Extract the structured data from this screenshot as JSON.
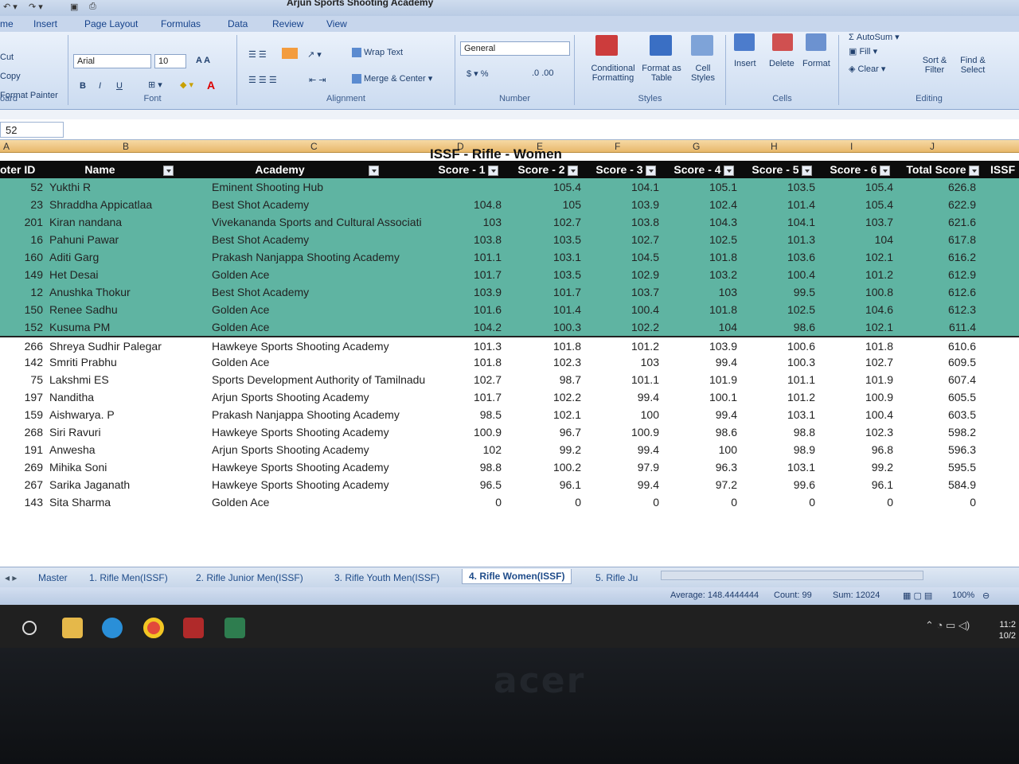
{
  "window": {
    "title": "Arjun Sports Shooting Academy"
  },
  "tabs": [
    "me",
    "Insert",
    "Page Layout",
    "Formulas",
    "Data",
    "Review",
    "View"
  ],
  "ribbon": {
    "clipboard": {
      "cut": "Cut",
      "copy": "Copy",
      "format_painter": "Format Painter",
      "label": "oard"
    },
    "font": {
      "name": "Arial",
      "size": "10",
      "label": "Font"
    },
    "alignment": {
      "wrap": "Wrap Text",
      "merge": "Merge & Center",
      "label": "Alignment"
    },
    "number": {
      "format": "General",
      "label": "Number"
    },
    "styles": {
      "conditional": "Conditional Formatting",
      "format_table": "Format as Table",
      "cell_styles": "Cell Styles",
      "label": "Styles"
    },
    "cells": {
      "insert": "Insert",
      "delete": "Delete",
      "format": "Format",
      "label": "Cells"
    },
    "editing": {
      "autosum": "AutoSum",
      "fill": "Fill",
      "clear": "Clear",
      "sort": "Sort & Filter",
      "find": "Find & Select",
      "label": "Editing"
    }
  },
  "formula_bar": {
    "name_box": "52"
  },
  "columns": [
    "A",
    "B",
    "C",
    "D",
    "E",
    "F",
    "G",
    "H",
    "I",
    "J"
  ],
  "sheet": {
    "banner": "ISSF - Rifle - Women",
    "headers": [
      "oter ID",
      "Name",
      "Academy",
      "Score - 1",
      "Score - 2",
      "Score - 3",
      "Score - 4",
      "Score - 5",
      "Score - 6",
      "Total Score",
      "ISSF"
    ],
    "rows": [
      {
        "id": "52",
        "name": "Yukthi R",
        "academy": "Eminent Shooting Hub",
        "s1": "",
        "s2": "105.4",
        "s3": "104.1",
        "s4": "105.1",
        "s5": "103.5",
        "s6": "105.4",
        "total": "626.8",
        "hl": true
      },
      {
        "id": "23",
        "name": "Shraddha Appicatlaa",
        "academy": "Best Shot Academy",
        "s1": "104.8",
        "s2": "105",
        "s3": "103.9",
        "s4": "102.4",
        "s5": "101.4",
        "s6": "105.4",
        "total": "622.9",
        "hl": true
      },
      {
        "id": "201",
        "name": "Kiran nandana",
        "academy": "Vivekananda Sports and Cultural Associati",
        "s1": "103",
        "s2": "102.7",
        "s3": "103.8",
        "s4": "104.3",
        "s5": "104.1",
        "s6": "103.7",
        "total": "621.6",
        "hl": true
      },
      {
        "id": "16",
        "name": "Pahuni Pawar",
        "academy": "Best Shot Academy",
        "s1": "103.8",
        "s2": "103.5",
        "s3": "102.7",
        "s4": "102.5",
        "s5": "101.3",
        "s6": "104",
        "total": "617.8",
        "hl": true
      },
      {
        "id": "160",
        "name": "Aditi Garg",
        "academy": "Prakash Nanjappa Shooting Academy",
        "s1": "101.1",
        "s2": "103.1",
        "s3": "104.5",
        "s4": "101.8",
        "s5": "103.6",
        "s6": "102.1",
        "total": "616.2",
        "hl": true
      },
      {
        "id": "149",
        "name": "Het Desai",
        "academy": "Golden Ace",
        "s1": "101.7",
        "s2": "103.5",
        "s3": "102.9",
        "s4": "103.2",
        "s5": "100.4",
        "s6": "101.2",
        "total": "612.9",
        "hl": true
      },
      {
        "id": "12",
        "name": "Anushka Thokur",
        "academy": "Best Shot Academy",
        "s1": "103.9",
        "s2": "101.7",
        "s3": "103.7",
        "s4": "103",
        "s5": "99.5",
        "s6": "100.8",
        "total": "612.6",
        "hl": true
      },
      {
        "id": "150",
        "name": "Renee Sadhu",
        "academy": "Golden Ace",
        "s1": "101.6",
        "s2": "101.4",
        "s3": "100.4",
        "s4": "101.8",
        "s5": "102.5",
        "s6": "104.6",
        "total": "612.3",
        "hl": true
      },
      {
        "id": "152",
        "name": "Kusuma PM",
        "academy": "Golden Ace",
        "s1": "104.2",
        "s2": "100.3",
        "s3": "102.2",
        "s4": "104",
        "s5": "98.6",
        "s6": "102.1",
        "total": "611.4",
        "hl": true
      },
      {
        "id": "266",
        "name": "Shreya Sudhir Palegar",
        "academy": "Hawkeye Sports Shooting Academy",
        "s1": "101.3",
        "s2": "101.8",
        "s3": "101.2",
        "s4": "103.9",
        "s5": "100.6",
        "s6": "101.8",
        "total": "610.6",
        "hl": false
      },
      {
        "id": "142",
        "name": "Smriti Prabhu",
        "academy": "Golden Ace",
        "s1": "101.8",
        "s2": "102.3",
        "s3": "103",
        "s4": "99.4",
        "s5": "100.3",
        "s6": "102.7",
        "total": "609.5",
        "hl": false
      },
      {
        "id": "75",
        "name": "Lakshmi ES",
        "academy": "Sports Development Authority of Tamilnadu",
        "s1": "102.7",
        "s2": "98.7",
        "s3": "101.1",
        "s4": "101.9",
        "s5": "101.1",
        "s6": "101.9",
        "total": "607.4",
        "hl": false
      },
      {
        "id": "197",
        "name": "Nanditha",
        "academy": "Arjun Sports Shooting Academy",
        "s1": "101.7",
        "s2": "102.2",
        "s3": "99.4",
        "s4": "100.1",
        "s5": "101.2",
        "s6": "100.9",
        "total": "605.5",
        "hl": false
      },
      {
        "id": "159",
        "name": "Aishwarya. P",
        "academy": "Prakash Nanjappa Shooting Academy",
        "s1": "98.5",
        "s2": "102.1",
        "s3": "100",
        "s4": "99.4",
        "s5": "103.1",
        "s6": "100.4",
        "total": "603.5",
        "hl": false
      },
      {
        "id": "268",
        "name": "Siri Ravuri",
        "academy": "Hawkeye Sports Shooting Academy",
        "s1": "100.9",
        "s2": "96.7",
        "s3": "100.9",
        "s4": "98.6",
        "s5": "98.8",
        "s6": "102.3",
        "total": "598.2",
        "hl": false
      },
      {
        "id": "191",
        "name": "Anwesha",
        "academy": "Arjun Sports Shooting Academy",
        "s1": "102",
        "s2": "99.2",
        "s3": "99.4",
        "s4": "100",
        "s5": "98.9",
        "s6": "96.8",
        "total": "596.3",
        "hl": false
      },
      {
        "id": "269",
        "name": "Mihika Soni",
        "academy": "Hawkeye Sports Shooting Academy",
        "s1": "98.8",
        "s2": "100.2",
        "s3": "97.9",
        "s4": "96.3",
        "s5": "103.1",
        "s6": "99.2",
        "total": "595.5",
        "hl": false
      },
      {
        "id": "267",
        "name": "Sarika Jaganath",
        "academy": "Hawkeye Sports Shooting Academy",
        "s1": "96.5",
        "s2": "96.1",
        "s3": "99.4",
        "s4": "97.2",
        "s5": "99.6",
        "s6": "96.1",
        "total": "584.9",
        "hl": false
      },
      {
        "id": "143",
        "name": "Sita Sharma",
        "academy": "Golden Ace",
        "s1": "0",
        "s2": "0",
        "s3": "0",
        "s4": "0",
        "s5": "0",
        "s6": "0",
        "total": "0",
        "hl": false
      }
    ]
  },
  "sheet_tabs": [
    "Master",
    "1. Rifle Men(ISSF)",
    "2. Rifle Junior Men(ISSF)",
    "3. Rifle Youth Men(ISSF)",
    "4. Rifle Women(ISSF)",
    "5. Rifle Ju"
  ],
  "active_sheet_index": 4,
  "status": {
    "average": "Average: 148.4444444",
    "count": "Count: 99",
    "sum": "Sum: 12024",
    "zoom": "100%"
  },
  "taskbar": {
    "clock_time": "11:2",
    "clock_date": "10/2",
    "brand": "acer"
  },
  "colors": {
    "highlight": "#5fb4a2",
    "header_bg": "#0c0c0c",
    "ribbon": "#cbdbf0"
  }
}
